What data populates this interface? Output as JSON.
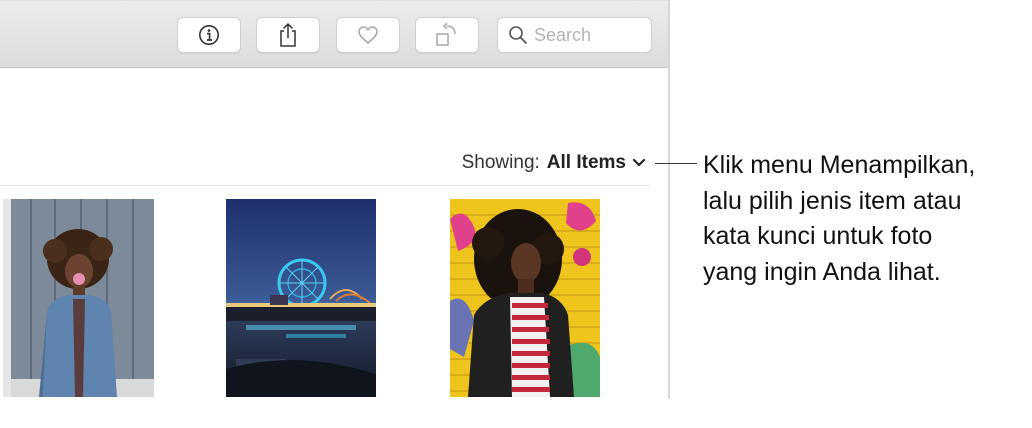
{
  "toolbar": {
    "buttons": [
      {
        "name": "info-button",
        "icon": "info-icon"
      },
      {
        "name": "share-button",
        "icon": "share-icon"
      },
      {
        "name": "favorite-button",
        "icon": "heart-icon"
      },
      {
        "name": "rotate-button",
        "icon": "rotate-icon"
      }
    ],
    "search": {
      "placeholder": "Search",
      "value": ""
    }
  },
  "filter": {
    "label": "Showing:",
    "value": "All Items"
  },
  "photos": [
    {
      "name": "photo-bubblegum-portrait"
    },
    {
      "name": "photo-pier-ferris-wheel"
    },
    {
      "name": "photo-yellow-wall-portrait"
    }
  ],
  "callout": {
    "lines": [
      "Klik menu Menampilkan,",
      "lalu pilih jenis item atau",
      "kata kunci untuk foto",
      "yang ingin Anda lihat."
    ]
  }
}
